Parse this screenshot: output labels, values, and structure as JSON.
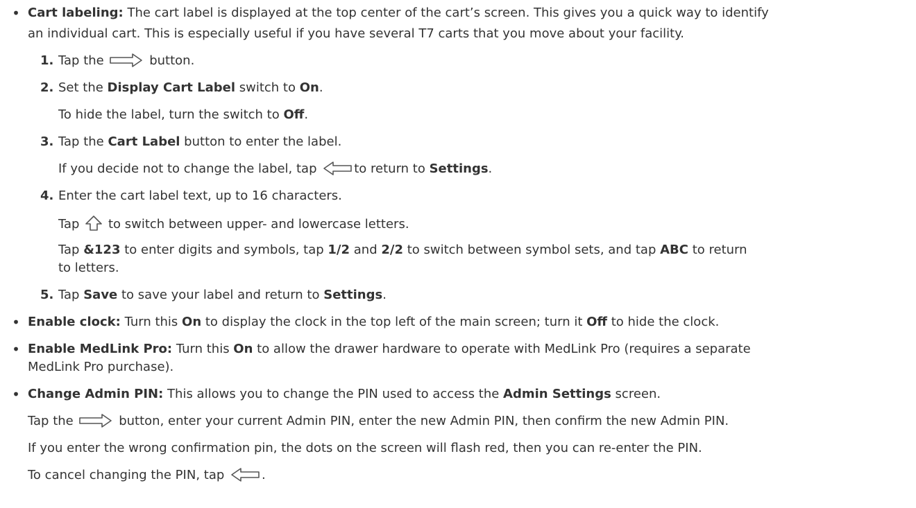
{
  "intro": {
    "label": "Cart labeling:",
    "line1": " The cart label is displayed at the top center of the cart’s screen. This gives you a quick way to identify",
    "line2": "an individual cart. This is especially useful if you have several T7 carts that you move about your facility."
  },
  "steps": [
    {
      "num": "1.",
      "parts": [
        "Tap the",
        "button."
      ]
    },
    {
      "num": "2.",
      "parts": [
        "Set the ",
        "Display Cart Label",
        " switch to ",
        "On",
        "."
      ],
      "sub": [
        "To hide the label, turn the switch to ",
        "Off",
        "."
      ]
    },
    {
      "num": "3.",
      "parts": [
        "Tap the ",
        "Cart Label",
        " button to enter the label."
      ],
      "sub": [
        "If you decide not to change the label, tap",
        "to return to ",
        "Settings",
        "."
      ]
    },
    {
      "num": "4.",
      "parts": [
        "Enter the cart label text, up to 16 characters."
      ],
      "sub": [
        "Tap",
        "to switch between upper- and lowercase letters."
      ],
      "sub2": [
        "Tap ",
        "&123",
        " to enter digits and symbols, tap ",
        "1/2",
        " and ",
        "2/2",
        " to switch between symbol sets, and tap ",
        "ABC",
        " to return"
      ],
      "sub2_cont": "to letters."
    },
    {
      "num": "5.",
      "parts": [
        "Tap ",
        "Save",
        " to save your label and return to ",
        "Settings",
        "."
      ]
    }
  ],
  "clock": {
    "label": "Enable clock:",
    "parts": [
      " Turn this ",
      "On",
      " to display the clock in the top left of the main screen; turn it ",
      "Off",
      " to hide the clock."
    ]
  },
  "medlink": {
    "label": "Enable MedLink Pro:",
    "parts": [
      " Turn this ",
      "On",
      " to allow the drawer hardware to operate with MedLink Pro (requires a separate"
    ],
    "cont": "MedLink Pro purchase)."
  },
  "pin": {
    "label": "Change Admin PIN:",
    "parts": [
      " This allows you to change the PIN used to access the ",
      "Admin Settings",
      " screen."
    ],
    "p1": [
      "Tap the",
      "button, enter your current Admin PIN, enter the new Admin PIN, then confirm the new Admin PIN."
    ],
    "p2": "If you enter the wrong confirmation pin, the dots on the screen will flash red, then you can re-enter the PIN.",
    "p3": [
      "To cancel changing the PIN, tap",
      "."
    ]
  },
  "bullet_char": "•",
  "icons": {
    "next": "right-arrow-icon",
    "back": "left-arrow-icon",
    "shift": "up-arrow-icon"
  },
  "colors": {
    "text": "#333333",
    "icon": "#555555"
  }
}
